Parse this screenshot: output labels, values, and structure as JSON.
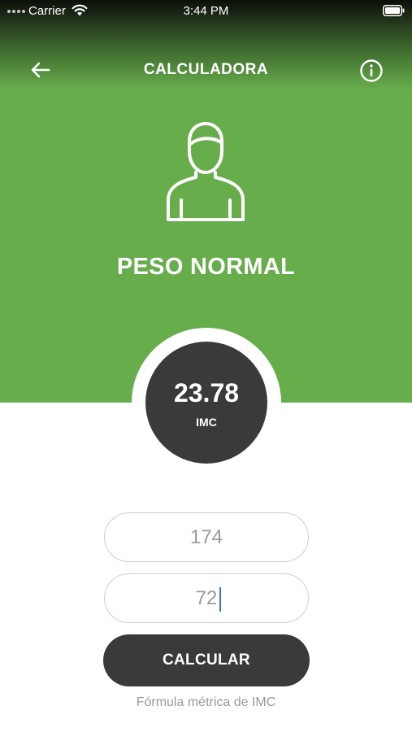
{
  "status_bar": {
    "carrier": "Carrier",
    "time": "3:44 PM",
    "signal_icon": "signal-dots-icon",
    "wifi_icon": "wifi-icon",
    "battery_icon": "battery-icon"
  },
  "nav": {
    "title": "CALCULADORA",
    "back_icon": "arrow-left-icon",
    "info_icon": "info-circle-icon"
  },
  "hero": {
    "icon": "person-icon",
    "status": "PESO NORMAL",
    "bg_color": "#67ad4b"
  },
  "result": {
    "value": "23.78",
    "label": "IMC",
    "circle_color": "#3a3a3a"
  },
  "form": {
    "height_value": "174",
    "weight_value": "72"
  },
  "actions": {
    "calculate_label": "CALCULAR",
    "formula_link": "Fórmula métrica de IMC"
  }
}
